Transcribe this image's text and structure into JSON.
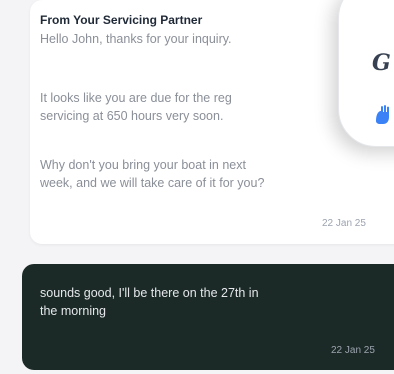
{
  "incoming_message": {
    "sender": "From Your Servicing Partner",
    "lines": [
      "Hello John, thanks for your inquiry.",
      "It looks like you are due for the reg",
      "servicing at 650 hours very soon.",
      "Why don't you bring your boat in next",
      "week, and we will take care of it for you?"
    ],
    "timestamp": "22 Jan 25"
  },
  "overlay": {
    "letter": "G",
    "icon": "hand-icon"
  },
  "outgoing_message": {
    "lines": [
      "sounds good, I'll be there on the 27th in",
      "the morning"
    ],
    "timestamp": "22 Jan 25"
  },
  "colors": {
    "incoming_bg": "#ffffff",
    "outgoing_bg": "#1b2a27",
    "muted_text": "#8a8f98",
    "overlay_icon": "#3b82f6"
  }
}
